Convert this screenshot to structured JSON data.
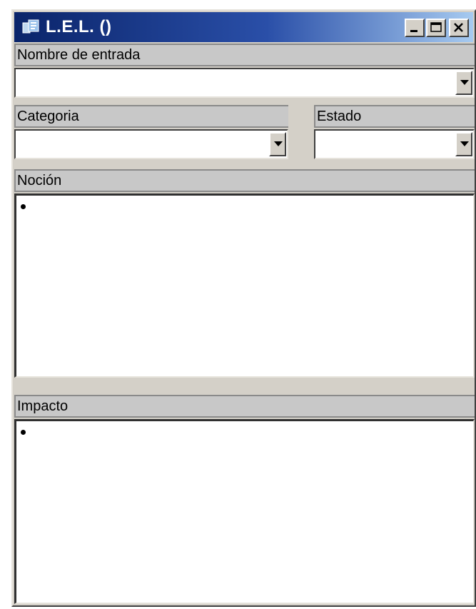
{
  "window": {
    "title": "L.E.L. ()",
    "buttons": [
      "minimize",
      "maximize",
      "close"
    ]
  },
  "fields": {
    "nombre_de_entrada": {
      "label": "Nombre de entrada",
      "value": ""
    },
    "categoria": {
      "label": "Categoria",
      "value": ""
    },
    "estado": {
      "label": "Estado",
      "value": ""
    },
    "nocion": {
      "label": "Noción",
      "value": ""
    },
    "impacto": {
      "label": "Impacto",
      "value": ""
    }
  },
  "icons": {
    "app": "app-icon",
    "dropdown": "chevron-down-icon",
    "bullet": "bullet-icon"
  },
  "colors": {
    "title_bar_start": "#0a246a",
    "title_bar_end": "#a6caf0",
    "window_face": "#d4d0c8",
    "header_bar": "#c8c8c8",
    "field_bg": "#ffffff"
  }
}
